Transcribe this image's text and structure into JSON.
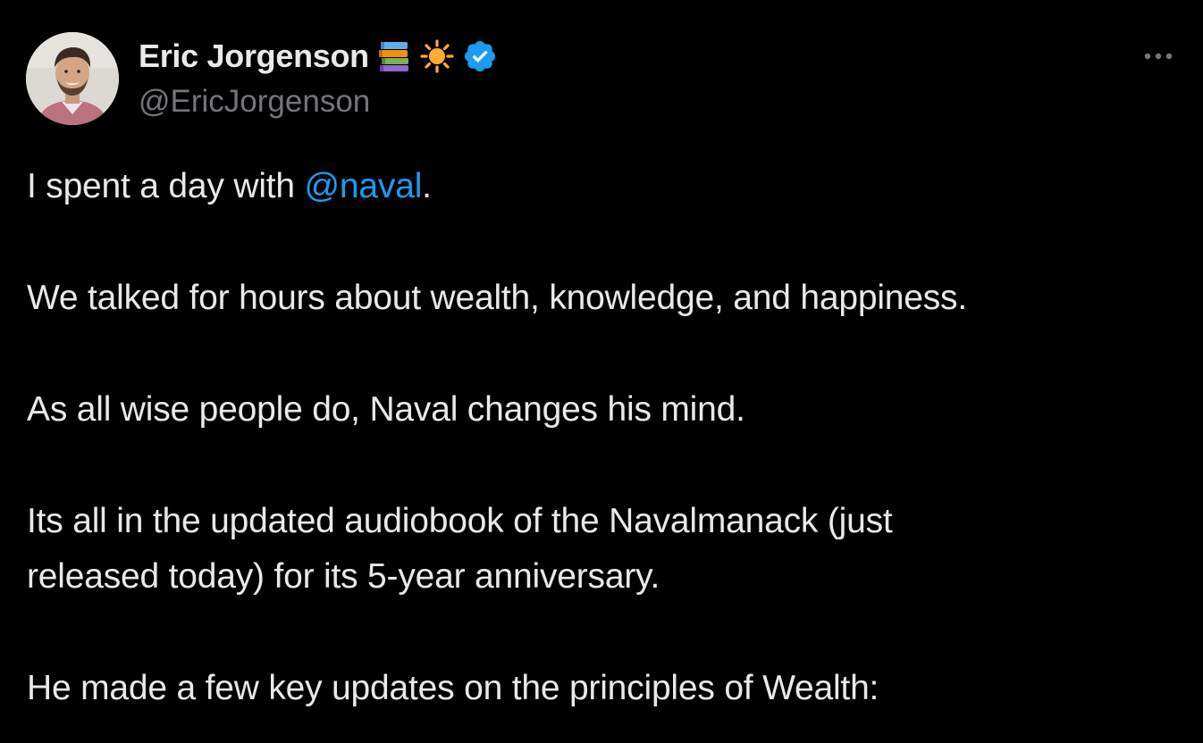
{
  "author": {
    "display_name": "Eric Jorgenson",
    "handle": "@EricJorgenson",
    "name_emojis": [
      "books-icon",
      "sun-icon"
    ],
    "verified": true,
    "verified_color": "#1d9bf0"
  },
  "menu": {
    "more_label": "···"
  },
  "tweet": {
    "line1_prefix": "I spent a day with ",
    "line1_mention": "@naval",
    "line1_suffix": ".",
    "para2": "We talked for hours about wealth, knowledge, and happiness.",
    "para3": "As all wise people do, Naval changes his mind.",
    "para4_line1": "Its all in the updated audiobook of the Navalmanack (just",
    "para4_line2": "released today) for its 5-year anniversary.",
    "para5": "He made a few key updates on the principles of Wealth:"
  },
  "colors": {
    "background": "#000000",
    "text": "#e7e9ea",
    "secondary_text": "#71767b",
    "link": "#1d9bf0"
  }
}
